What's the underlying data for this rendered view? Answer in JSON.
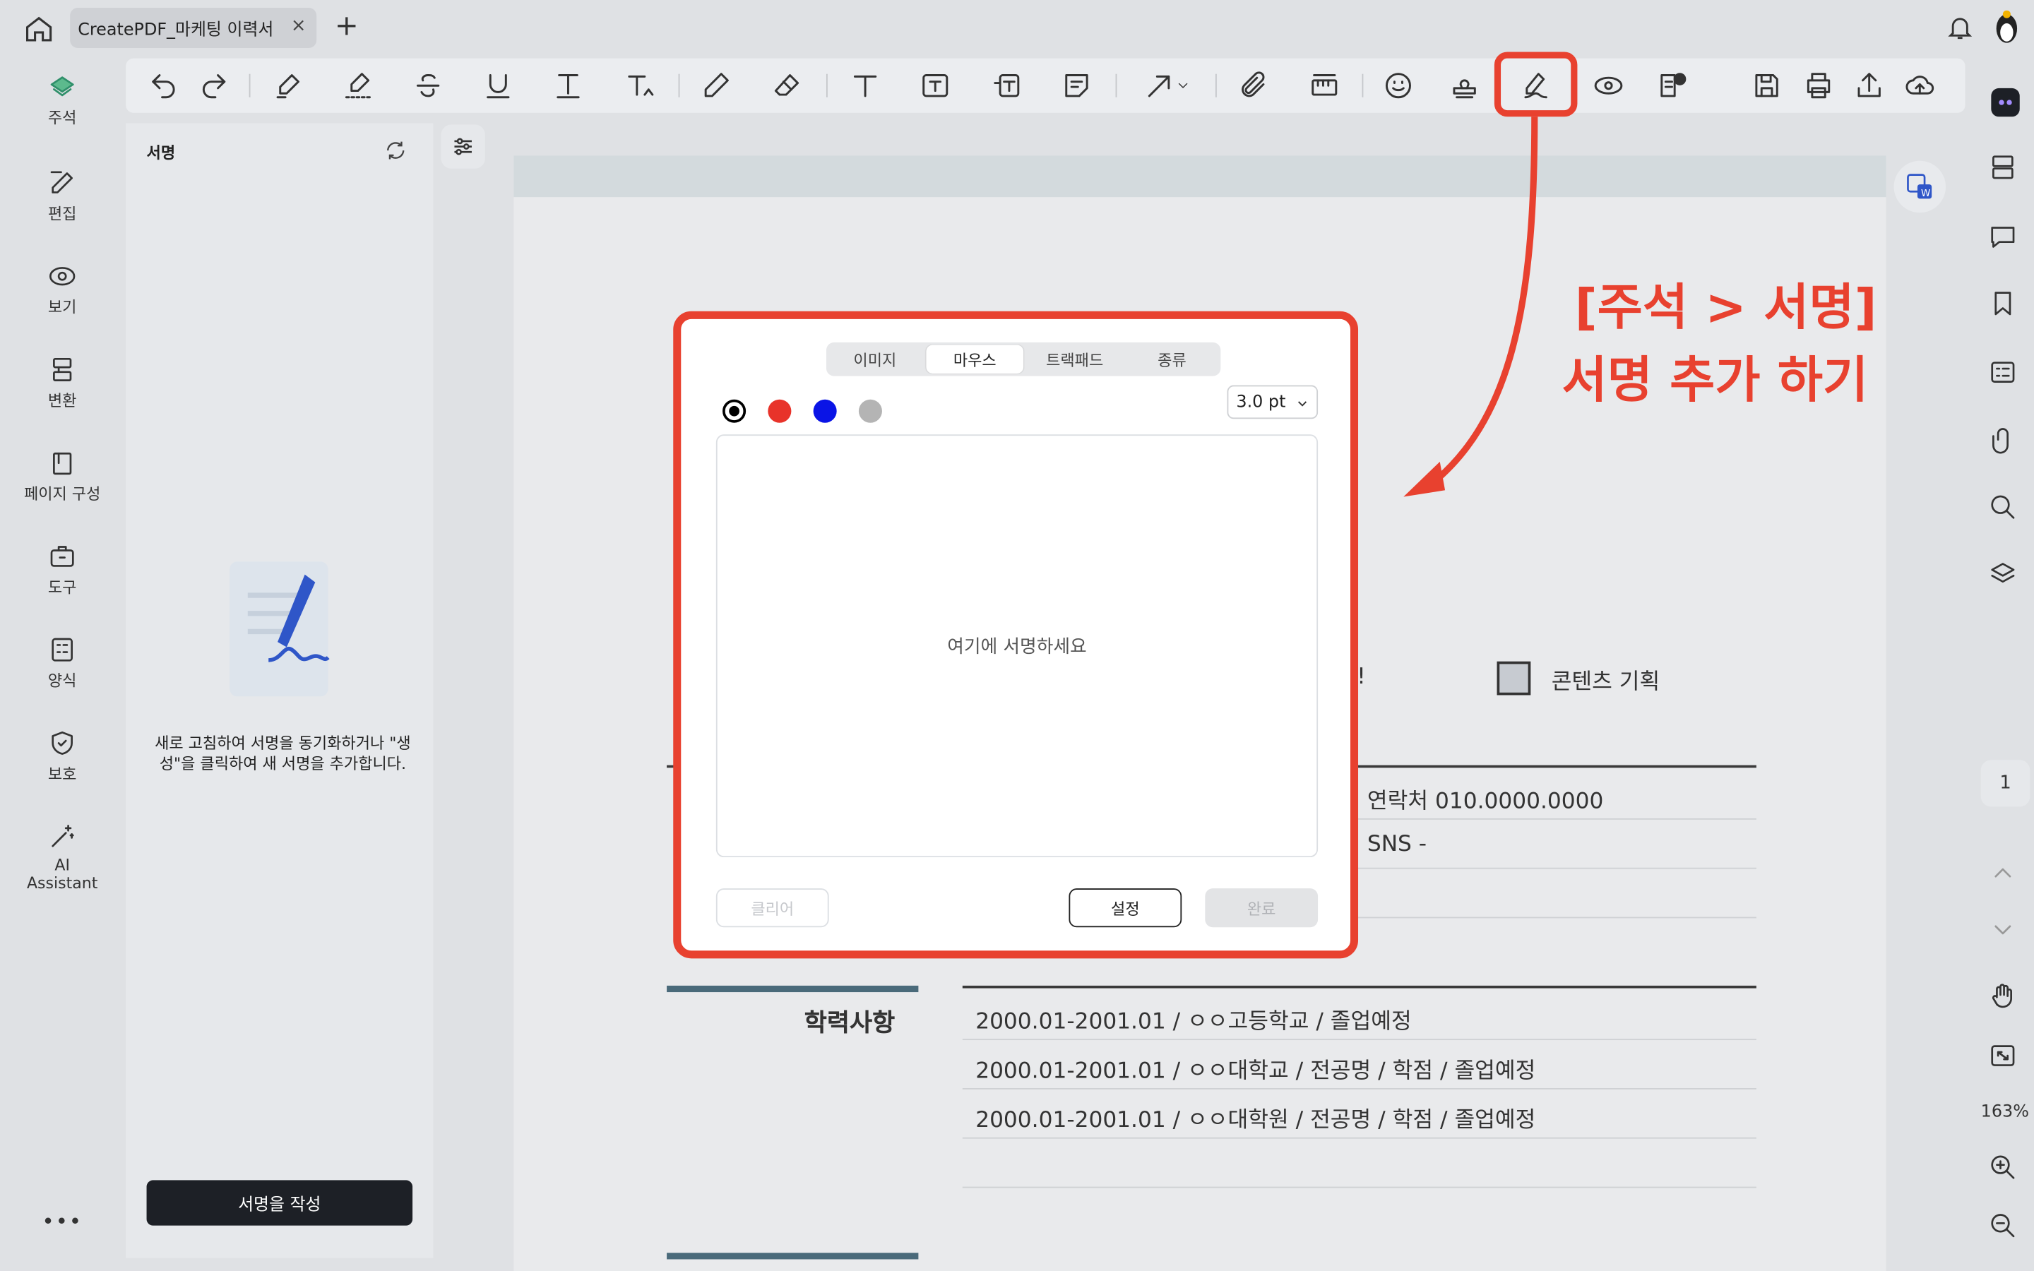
{
  "tab": {
    "title": "CreatePDF_마케팅 이력서",
    "close": "×",
    "new": "+"
  },
  "left_nav": [
    {
      "label": "주석"
    },
    {
      "label": "편집"
    },
    {
      "label": "보기"
    },
    {
      "label": "변환"
    },
    {
      "label": "페이지 구성"
    },
    {
      "label": "도구"
    },
    {
      "label": "양식"
    },
    {
      "label": "보호"
    },
    {
      "label": "AI"
    },
    {
      "label2": "Assistant"
    }
  ],
  "nav": {
    "annot": "주석",
    "edit": "편집",
    "view": "보기",
    "convert": "변환",
    "pages": "페이지 구성",
    "tools": "도구",
    "forms": "양식",
    "protect": "보호",
    "ai1": "AI",
    "ai2": "Assistant",
    "more": "•••"
  },
  "panel": {
    "title": "서명",
    "hint": "새로 고침하여 서명을 동기화하거나 \"생성\"을 클릭하여 새 서명을 추가합니다.",
    "hint1": "새로 고침하여 서명을 동기화하거나 \"생",
    "hint2": "성\"을 클릭하여 새 서명을 추가합니다.",
    "create_button": "서명을 작성"
  },
  "annotation": {
    "line1": "[주석 > 서명]",
    "line2": "서명 추가 하기",
    "color": "#e8412f"
  },
  "dialog": {
    "tabs": [
      "이미지",
      "마우스",
      "트랙패드",
      "종류"
    ],
    "active_tab": "마우스",
    "colors": [
      "#000000",
      "#e8332a",
      "#0a14e6",
      "#b4b4b4"
    ],
    "stroke_size": "3.0 pt",
    "placeholder": "여기에 서명하세요",
    "clear": "클리어",
    "settings": "설정",
    "done": "완료"
  },
  "document": {
    "checkbox_label": "콘텐츠 기획",
    "partial_char": "!",
    "contact": "연락처  010.0000.0000",
    "sns": "SNS -",
    "section_title": "학력사항",
    "education": [
      "2000.01-2001.01 / ㅇㅇ고등학교 / 졸업예정",
      "2000.01-2001.01 / ㅇㅇ대학교 / 전공명 / 학점 / 졸업예정",
      "2000.01-2001.01 / ㅇㅇ대학원 / 전공명 / 학점 / 졸업예정"
    ]
  },
  "right_rail": {
    "page": "1",
    "zoom": "163%"
  }
}
